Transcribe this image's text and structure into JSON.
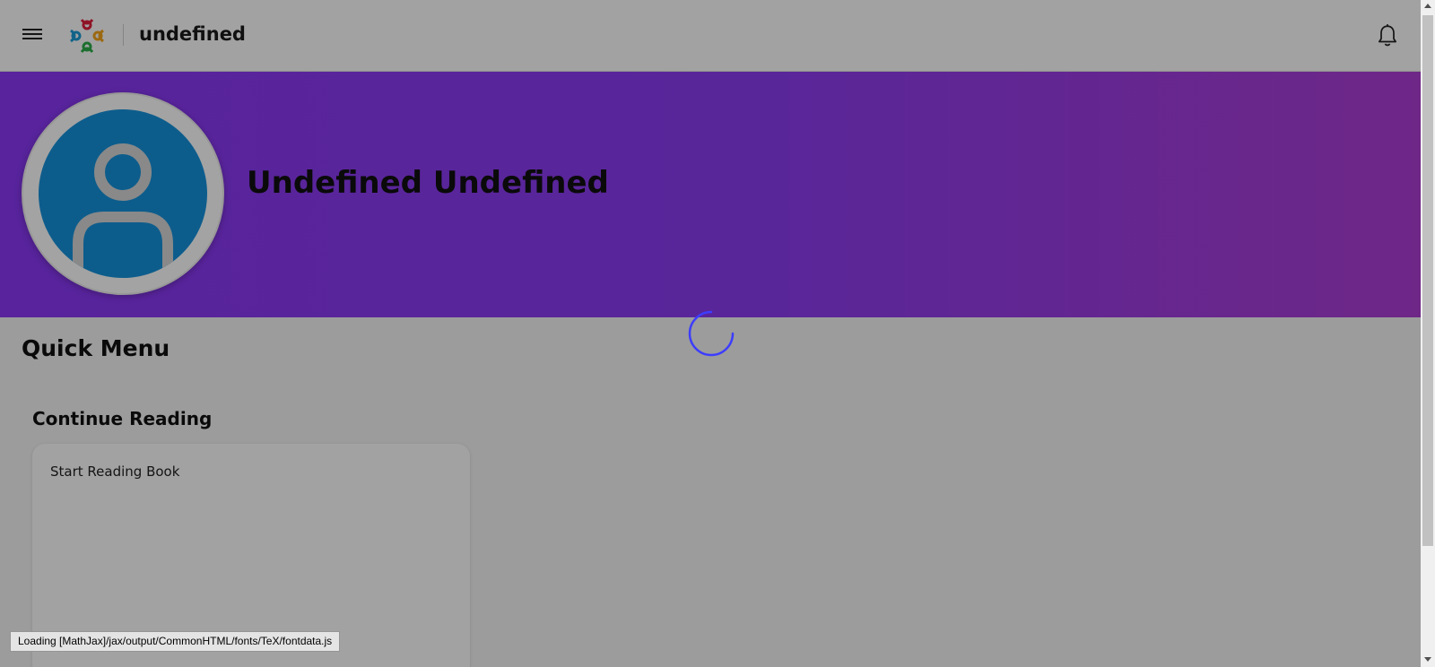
{
  "header": {
    "app_title": "undefined",
    "menu_icon": "hamburger-menu-icon",
    "logo_icon": "people-circle-logo",
    "bell_icon": "bell-icon"
  },
  "banner": {
    "profile_name": "Undefined Undefined",
    "avatar_icon": "user-avatar-icon",
    "gradient": [
      "#8a38f5",
      "#ad3dd4"
    ]
  },
  "main": {
    "quick_menu_title": "Quick Menu",
    "continue_reading_title": "Continue Reading",
    "card_text": "Start Reading Book"
  },
  "loading": {
    "spinner_icon": "loading-spinner-icon",
    "status_text": "Loading [MathJax]/jax/output/CommonHTML/fonts/TeX/fontdata.js"
  },
  "colors": {
    "accent": "#8c3cf0",
    "avatar_bg": "#1592dc",
    "spinner": "#3d3dff"
  }
}
